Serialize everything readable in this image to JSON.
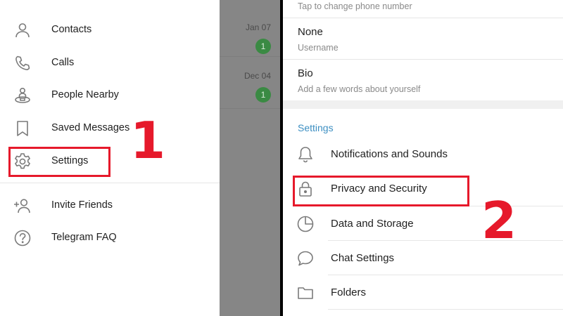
{
  "colors": {
    "accent": "#3d8fc2",
    "annotation_red": "#e6192b",
    "badge_green": "#3a8a43",
    "dim_overlay": "#868686"
  },
  "left_panel": {
    "chat_list": [
      {
        "date": "",
        "unread": ""
      },
      {
        "date": "Jan 07",
        "unread": "1"
      },
      {
        "date": "Dec 04",
        "unread": "1"
      }
    ],
    "menu": [
      {
        "label": "Contacts",
        "icon": "person-icon"
      },
      {
        "label": "Calls",
        "icon": "phone-icon"
      },
      {
        "label": "People Nearby",
        "icon": "people-nearby-icon"
      },
      {
        "label": "Saved Messages",
        "icon": "bookmark-icon"
      },
      {
        "label": "Settings",
        "icon": "gear-icon"
      },
      {
        "label": "Invite Friends",
        "icon": "add-person-icon"
      },
      {
        "label": "Telegram FAQ",
        "icon": "question-icon"
      }
    ],
    "step_label": "1"
  },
  "right_panel": {
    "phone_hint": "Tap to change phone number",
    "username": {
      "value": "None",
      "caption": "Username"
    },
    "bio": {
      "value": "Bio",
      "caption": "Add a few words about yourself"
    },
    "section_title": "Settings",
    "items": [
      {
        "label": "Notifications and Sounds",
        "icon": "bell-icon"
      },
      {
        "label": "Privacy and Security",
        "icon": "lock-icon"
      },
      {
        "label": "Data and Storage",
        "icon": "pie-chart-icon"
      },
      {
        "label": "Chat Settings",
        "icon": "chat-bubble-icon"
      },
      {
        "label": "Folders",
        "icon": "folder-icon"
      }
    ],
    "step_label": "2"
  }
}
